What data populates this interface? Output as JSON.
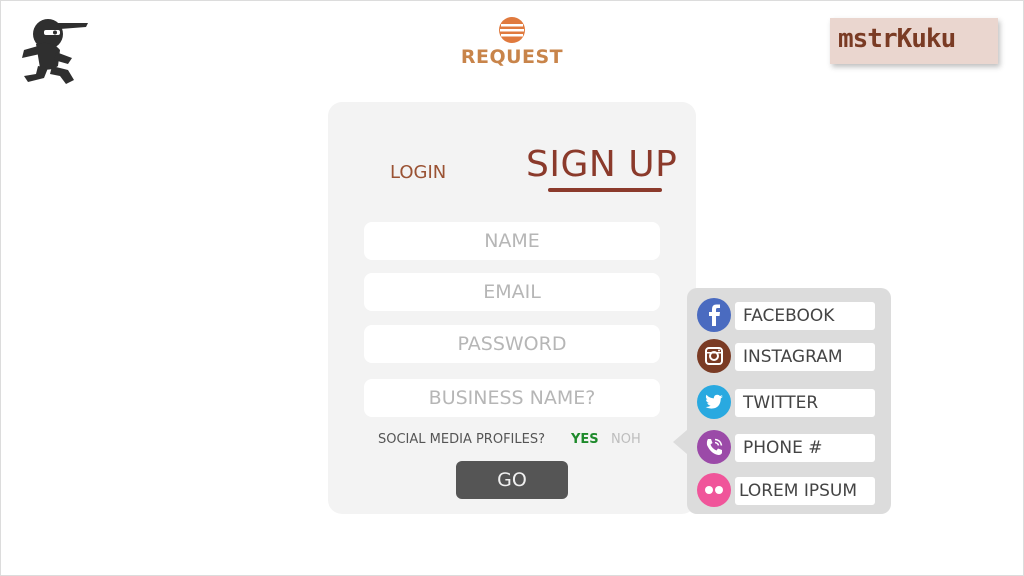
{
  "header": {
    "brand": {
      "name": "REQUEST",
      "icon": "striped-circle-icon",
      "color": "#c8844a"
    },
    "badge": {
      "text": "mstrKuku"
    }
  },
  "auth": {
    "tabs": {
      "login": "LOGIN",
      "signup": "SIGN UP",
      "active": "signup"
    },
    "fields": {
      "name": "NAME",
      "email": "EMAIL",
      "password": "PASSWORD",
      "business": "BUSINESS NAME?"
    },
    "social_question": "SOCIAL MEDIA PROFILES?",
    "yes_label": "YES",
    "no_label": "NOH",
    "go_label": "GO"
  },
  "social": [
    {
      "icon": "facebook-icon",
      "label": "FACEBOOK",
      "color": "#4a6bc0"
    },
    {
      "icon": "instagram-icon",
      "label": "INSTAGRAM",
      "color": "#7a3b24"
    },
    {
      "icon": "twitter-icon",
      "label": "TWITTER",
      "color": "#29a9e0"
    },
    {
      "icon": "phone-icon",
      "label": "PHONE #",
      "color": "#9b4aa8"
    },
    {
      "icon": "flickr-icon",
      "label": "LOREM IPSUM",
      "color": "#f0559a"
    }
  ],
  "colors": {
    "accent": "#8b3a2b",
    "yes_green": "#1e8a2b",
    "button_bg": "#555555"
  }
}
